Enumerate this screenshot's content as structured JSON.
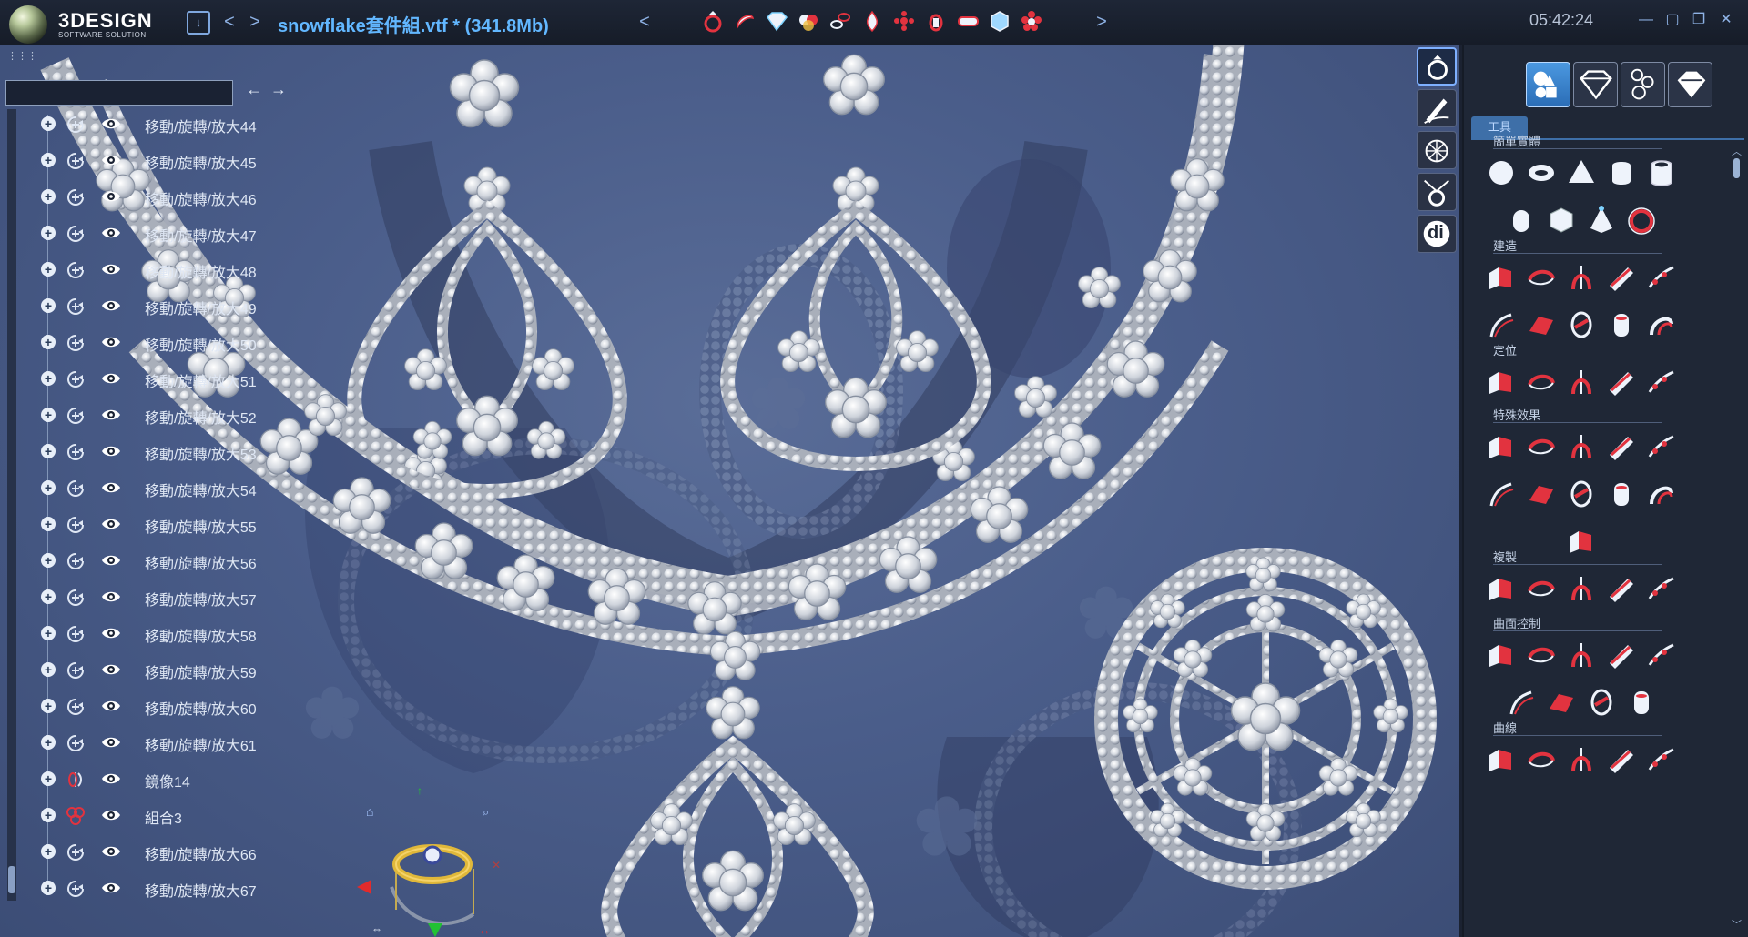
{
  "titlebar": {
    "logo_word": "3DESIGN",
    "logo_sub": "SOFTWARE SOLUTION",
    "file_title": "snowflake套件組.vtf *  (341.8Mb)",
    "clock": "05:42:24",
    "back_glyph": "<",
    "forward_glyph": ">",
    "icon_scroll_left": "<",
    "icon_scroll_right": ">",
    "save_glyph": "↓",
    "quick_icons": [
      "ring-icon",
      "bracelet-icon",
      "gem-icon",
      "color-gems-icon",
      "chain-icon",
      "drop-icon",
      "cluster-icon",
      "pendant-icon",
      "band-icon",
      "box-icon",
      "flower-icon"
    ],
    "window_controls": [
      "minimize",
      "maximize",
      "restore",
      "close"
    ],
    "window_glyphs": [
      "—",
      "▢",
      "❐",
      "✕"
    ]
  },
  "tree": {
    "search_value": "",
    "back_glyph": "←",
    "forward_glyph": "→",
    "rows": [
      {
        "label": "移動/旋轉/放大44",
        "kind": "transform"
      },
      {
        "label": "移動/旋轉/放大45",
        "kind": "transform"
      },
      {
        "label": "移動/旋轉/放大46",
        "kind": "transform"
      },
      {
        "label": "移動/旋轉/放大47",
        "kind": "transform"
      },
      {
        "label": "移動/旋轉/放大48",
        "kind": "transform"
      },
      {
        "label": "移動/旋轉/放大49",
        "kind": "transform"
      },
      {
        "label": "移動/旋轉/放大50",
        "kind": "transform"
      },
      {
        "label": "移動/旋轉/放大51",
        "kind": "transform"
      },
      {
        "label": "移動/旋轉/放大52",
        "kind": "transform"
      },
      {
        "label": "移動/旋轉/放大53",
        "kind": "transform"
      },
      {
        "label": "移動/旋轉/放大54",
        "kind": "transform"
      },
      {
        "label": "移動/旋轉/放大55",
        "kind": "transform"
      },
      {
        "label": "移動/旋轉/放大56",
        "kind": "transform"
      },
      {
        "label": "移動/旋轉/放大57",
        "kind": "transform"
      },
      {
        "label": "移動/旋轉/放大58",
        "kind": "transform"
      },
      {
        "label": "移動/旋轉/放大59",
        "kind": "transform"
      },
      {
        "label": "移動/旋轉/放大60",
        "kind": "transform"
      },
      {
        "label": "移動/旋轉/放大61",
        "kind": "transform"
      },
      {
        "label": "鏡像14",
        "kind": "mirror"
      },
      {
        "label": "組合3",
        "kind": "group"
      },
      {
        "label": "移動/旋轉/放大66",
        "kind": "transform"
      },
      {
        "label": "移動/旋轉/放大67",
        "kind": "transform"
      }
    ]
  },
  "mode_column": {
    "buttons": [
      "ring-mode",
      "sketch-mode",
      "network-mode",
      "pendant-mode",
      "di-mode"
    ],
    "di_label": "di",
    "dropdown_glyph": "▼"
  },
  "tool_panel": {
    "tabs": [
      "objects-tab",
      "gem-tab",
      "setting-tab",
      "gem-setting-tab"
    ],
    "active_tab": "objects-tab",
    "tools_tab_label": "工具",
    "sections": [
      {
        "title": "簡單實體",
        "tools": [
          "sphere",
          "torus",
          "cone",
          "cylinder",
          "tube",
          "capsule",
          "cube",
          "pyramid",
          "ring-primitive"
        ]
      },
      {
        "title": "建造",
        "tools": [
          "extrude",
          "sweep",
          "revolve",
          "loft",
          "multi-rail",
          "curve-sweep",
          "surface-patch",
          "shell",
          "cylinder-build",
          "blend"
        ]
      },
      {
        "title": "定位",
        "tools": [
          "move",
          "rotate-snap",
          "align-gem",
          "flip",
          "place"
        ]
      },
      {
        "title": "特殊效果",
        "tools": [
          "boolean",
          "pattern-box",
          "torus-effect",
          "saucer",
          "bend",
          "cylinder-effect",
          "color-merge",
          "mesh-grid",
          "wireframe",
          "polyhedron",
          "align-view"
        ]
      },
      {
        "title": "複製",
        "tools": [
          "copy-circle",
          "copy-rotate",
          "grid-array",
          "circle-array",
          "line-array"
        ]
      },
      {
        "title": "曲面控制",
        "tools": [
          "cube-control",
          "scoop",
          "box-a",
          "box-b",
          "box-c",
          "spin",
          "deform",
          "melt",
          "arc-control"
        ]
      },
      {
        "title": "曲線",
        "tools": [
          "curve-a",
          "curve-b",
          "curve-c",
          "curve-d",
          "curve-e"
        ]
      }
    ]
  },
  "colors": {
    "accent": "#62b7ff",
    "viewport_bg": "#4a5d8a",
    "panel_bg": "#1f2736",
    "tool_red": "#e2333f",
    "tool_white": "#eef3fb"
  }
}
